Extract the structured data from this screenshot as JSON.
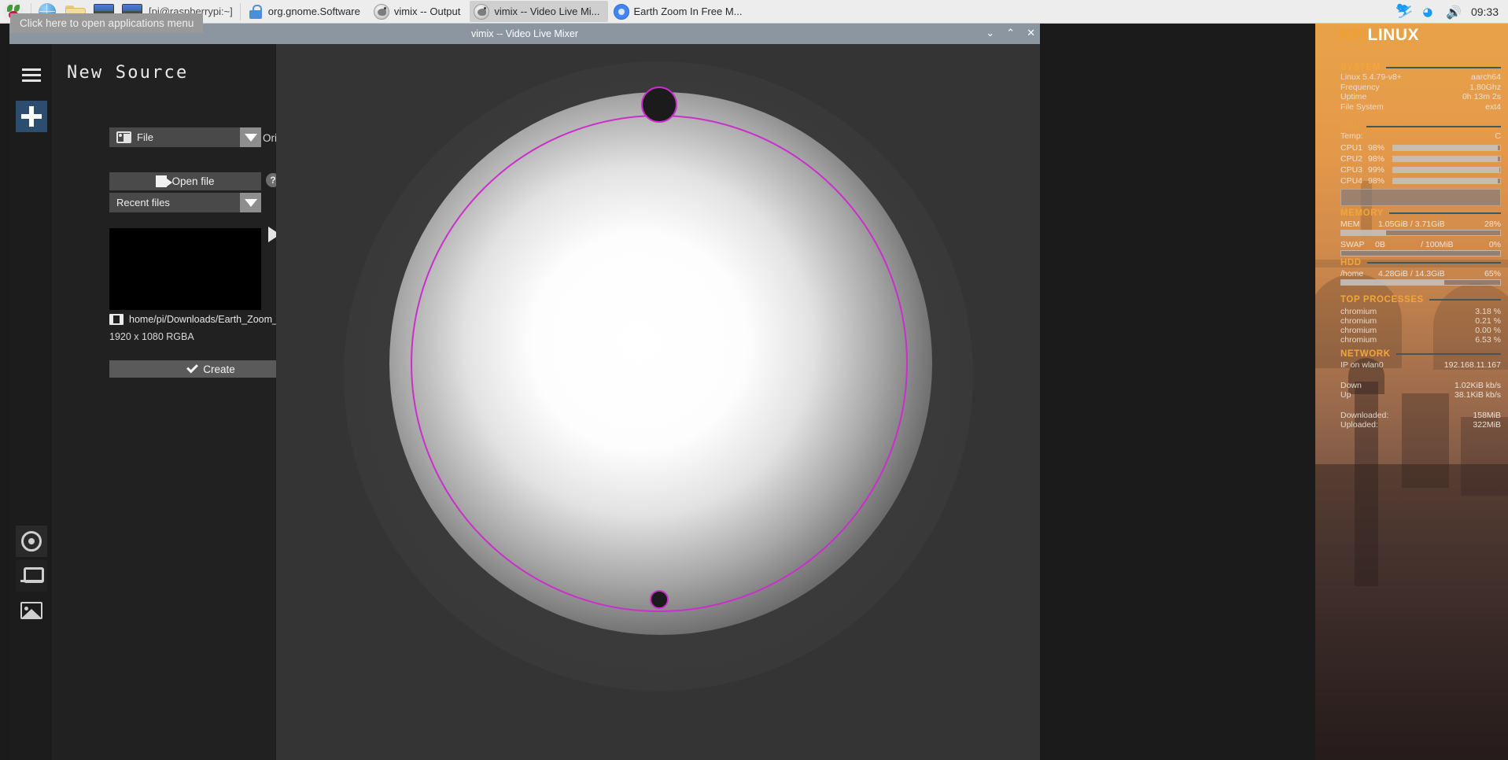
{
  "taskbar": {
    "launchers": [
      {
        "name": "raspberry-menu",
        "icon": "raspberry-icon"
      },
      {
        "name": "web-browser",
        "icon": "globe-icon"
      },
      {
        "name": "file-manager",
        "icon": "folder-icon"
      },
      {
        "name": "terminal-1",
        "icon": "terminal-icon"
      },
      {
        "name": "terminal-2",
        "icon": "terminal-icon"
      }
    ],
    "terminal_stub": "[pi@raspberrypi:~]",
    "windows": [
      {
        "label": "org.gnome.Software",
        "icon": "gnome-software-icon",
        "active": false
      },
      {
        "label": "vimix -- Output",
        "icon": "vimix-icon",
        "active": false
      },
      {
        "label": "vimix -- Video Live Mi...",
        "icon": "vimix-icon",
        "active": true
      },
      {
        "label": "Earth Zoom In Free M...",
        "icon": "chromium-icon",
        "active": false
      }
    ],
    "tray": {
      "bluetooth_icon": "bluetooth-icon",
      "wifi_icon": "wifi-icon",
      "volume_icon": "volume-icon",
      "clock": "09:33"
    }
  },
  "tooltip": {
    "text": "Click here to open applications menu"
  },
  "vimix": {
    "window_title": "vimix -- Video Live Mixer",
    "window_buttons": {
      "minimize": "⌄",
      "maximize": "⌃",
      "close": "✕"
    },
    "rail": [
      {
        "name": "menu",
        "icon": "hamburger-icon"
      },
      {
        "name": "new-source",
        "icon": "plus-icon"
      },
      {
        "name": "output",
        "icon": "target-icon"
      },
      {
        "name": "mixer",
        "icon": "mixer-icon"
      },
      {
        "name": "library",
        "icon": "library-icon"
      }
    ],
    "panel": {
      "title": "New Source",
      "origin_select_value": "File",
      "origin_label": "Origin",
      "open_file_label": "Open file",
      "help_label": "?",
      "recent_files_value": "Recent files",
      "play_icon": "play-icon",
      "file_path": "home/pi/Downloads/Earth_Zoom_In.mov",
      "file_resolution": "1920 x 1080 RGBA",
      "create_label": "Create"
    },
    "canvas": {
      "selection_color": "#cb2ecb"
    }
  },
  "rpi_monitor": {
    "title_bold": "RPI",
    "title_light": "LINUX",
    "system": {
      "header": "SYSTEM",
      "rows": [
        {
          "key": "Linux 5.4.79-v8+",
          "value": "aarch64"
        },
        {
          "key": "Frequency",
          "value": "1.80Ghz"
        },
        {
          "key": "Uptime",
          "value": "0h 13m 2s"
        },
        {
          "key": "File System",
          "value": "ext4"
        }
      ]
    },
    "cpu": {
      "header": "CPU",
      "temp_label": "Temp:",
      "temp_value": "C",
      "cores": [
        {
          "label": "CPU1",
          "pct": "98%",
          "value": 98
        },
        {
          "label": "CPU2",
          "pct": "98%",
          "value": 98
        },
        {
          "label": "CPU3",
          "pct": "99%",
          "value": 99
        },
        {
          "label": "CPU4",
          "pct": "98%",
          "value": 98
        }
      ]
    },
    "memory": {
      "header": "MEMORY",
      "mem": {
        "label": "MEM",
        "usage": "1.05GiB / 3.71GiB",
        "pct": "28%",
        "value": 28
      },
      "swap": {
        "label": "SWAP",
        "used": "0B",
        "total": "/ 100MiB",
        "pct": "0%",
        "value": 0
      }
    },
    "hdd": {
      "header": "HDD",
      "mount": "/home",
      "usage": "4.28GiB / 14.3GiB",
      "pct": "65%",
      "value": 65
    },
    "processes": {
      "header": "TOP PROCESSES",
      "items": [
        {
          "name": "chromium",
          "cpu": "3.18 %"
        },
        {
          "name": "chromium",
          "cpu": "0.21 %"
        },
        {
          "name": "chromium",
          "cpu": "0.00 %"
        },
        {
          "name": "chromium",
          "cpu": "6.53 %"
        }
      ]
    },
    "network": {
      "header": "NETWORK",
      "ip_label": "IP on wlan0",
      "ip_value": "192.168.11.167",
      "down_label": "Down",
      "down_value": "1.02KiB kb/s",
      "up_label": "Up",
      "up_value": "38.1KiB kb/s",
      "downloaded_label": "Downloaded:",
      "downloaded_value": "158MiB",
      "uploaded_label": "Uploaded:",
      "uploaded_value": "322MiB"
    }
  }
}
